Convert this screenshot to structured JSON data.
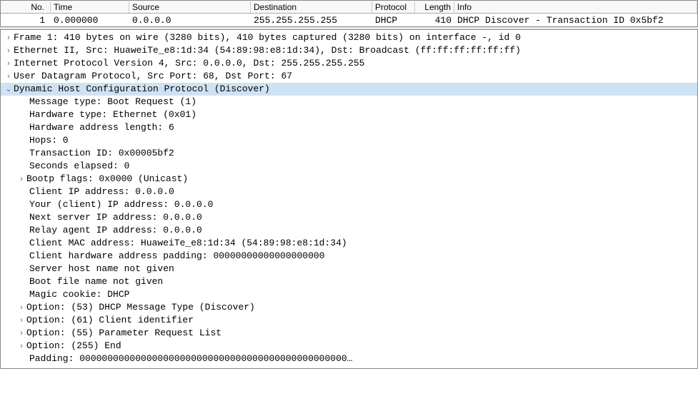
{
  "packet_list": {
    "headers": {
      "no": "No.",
      "time": "Time",
      "source": "Source",
      "destination": "Destination",
      "protocol": "Protocol",
      "length": "Length",
      "info": "Info"
    },
    "rows": [
      {
        "no": "1",
        "time": "0.000000",
        "source": "0.0.0.0",
        "destination": "255.255.255.255",
        "protocol": "DHCP",
        "length": "410",
        "info": "DHCP Discover - Transaction ID 0x5bf2"
      }
    ]
  },
  "details": {
    "frame": "Frame 1: 410 bytes on wire (3280 bits), 410 bytes captured (3280 bits) on interface -, id 0",
    "eth": "Ethernet II, Src: HuaweiTe_e8:1d:34 (54:89:98:e8:1d:34), Dst: Broadcast (ff:ff:ff:ff:ff:ff)",
    "ip": "Internet Protocol Version 4, Src: 0.0.0.0, Dst: 255.255.255.255",
    "udp": "User Datagram Protocol, Src Port: 68, Dst Port: 67",
    "dhcp_header": "Dynamic Host Configuration Protocol (Discover)",
    "dhcp": {
      "msg_type": "Message type: Boot Request (1)",
      "hw_type": "Hardware type: Ethernet (0x01)",
      "hw_len": "Hardware address length: 6",
      "hops": "Hops: 0",
      "xid": "Transaction ID: 0x00005bf2",
      "secs": "Seconds elapsed: 0",
      "flags": "Bootp flags: 0x0000 (Unicast)",
      "ciaddr": "Client IP address: 0.0.0.0",
      "yiaddr": "Your (client) IP address: 0.0.0.0",
      "siaddr": "Next server IP address: 0.0.0.0",
      "giaddr": "Relay agent IP address: 0.0.0.0",
      "chaddr": "Client MAC address: HuaweiTe_e8:1d:34 (54:89:98:e8:1d:34)",
      "padding": "Client hardware address padding: 00000000000000000000",
      "sname": "Server host name not given",
      "file": "Boot file name not given",
      "cookie": "Magic cookie: DHCP",
      "opt53": "Option: (53) DHCP Message Type (Discover)",
      "opt61": "Option: (61) Client identifier",
      "opt55": "Option: (55) Parameter Request List",
      "opt255": "Option: (255) End",
      "pad": "Padding: 000000000000000000000000000000000000000000000000…"
    }
  }
}
